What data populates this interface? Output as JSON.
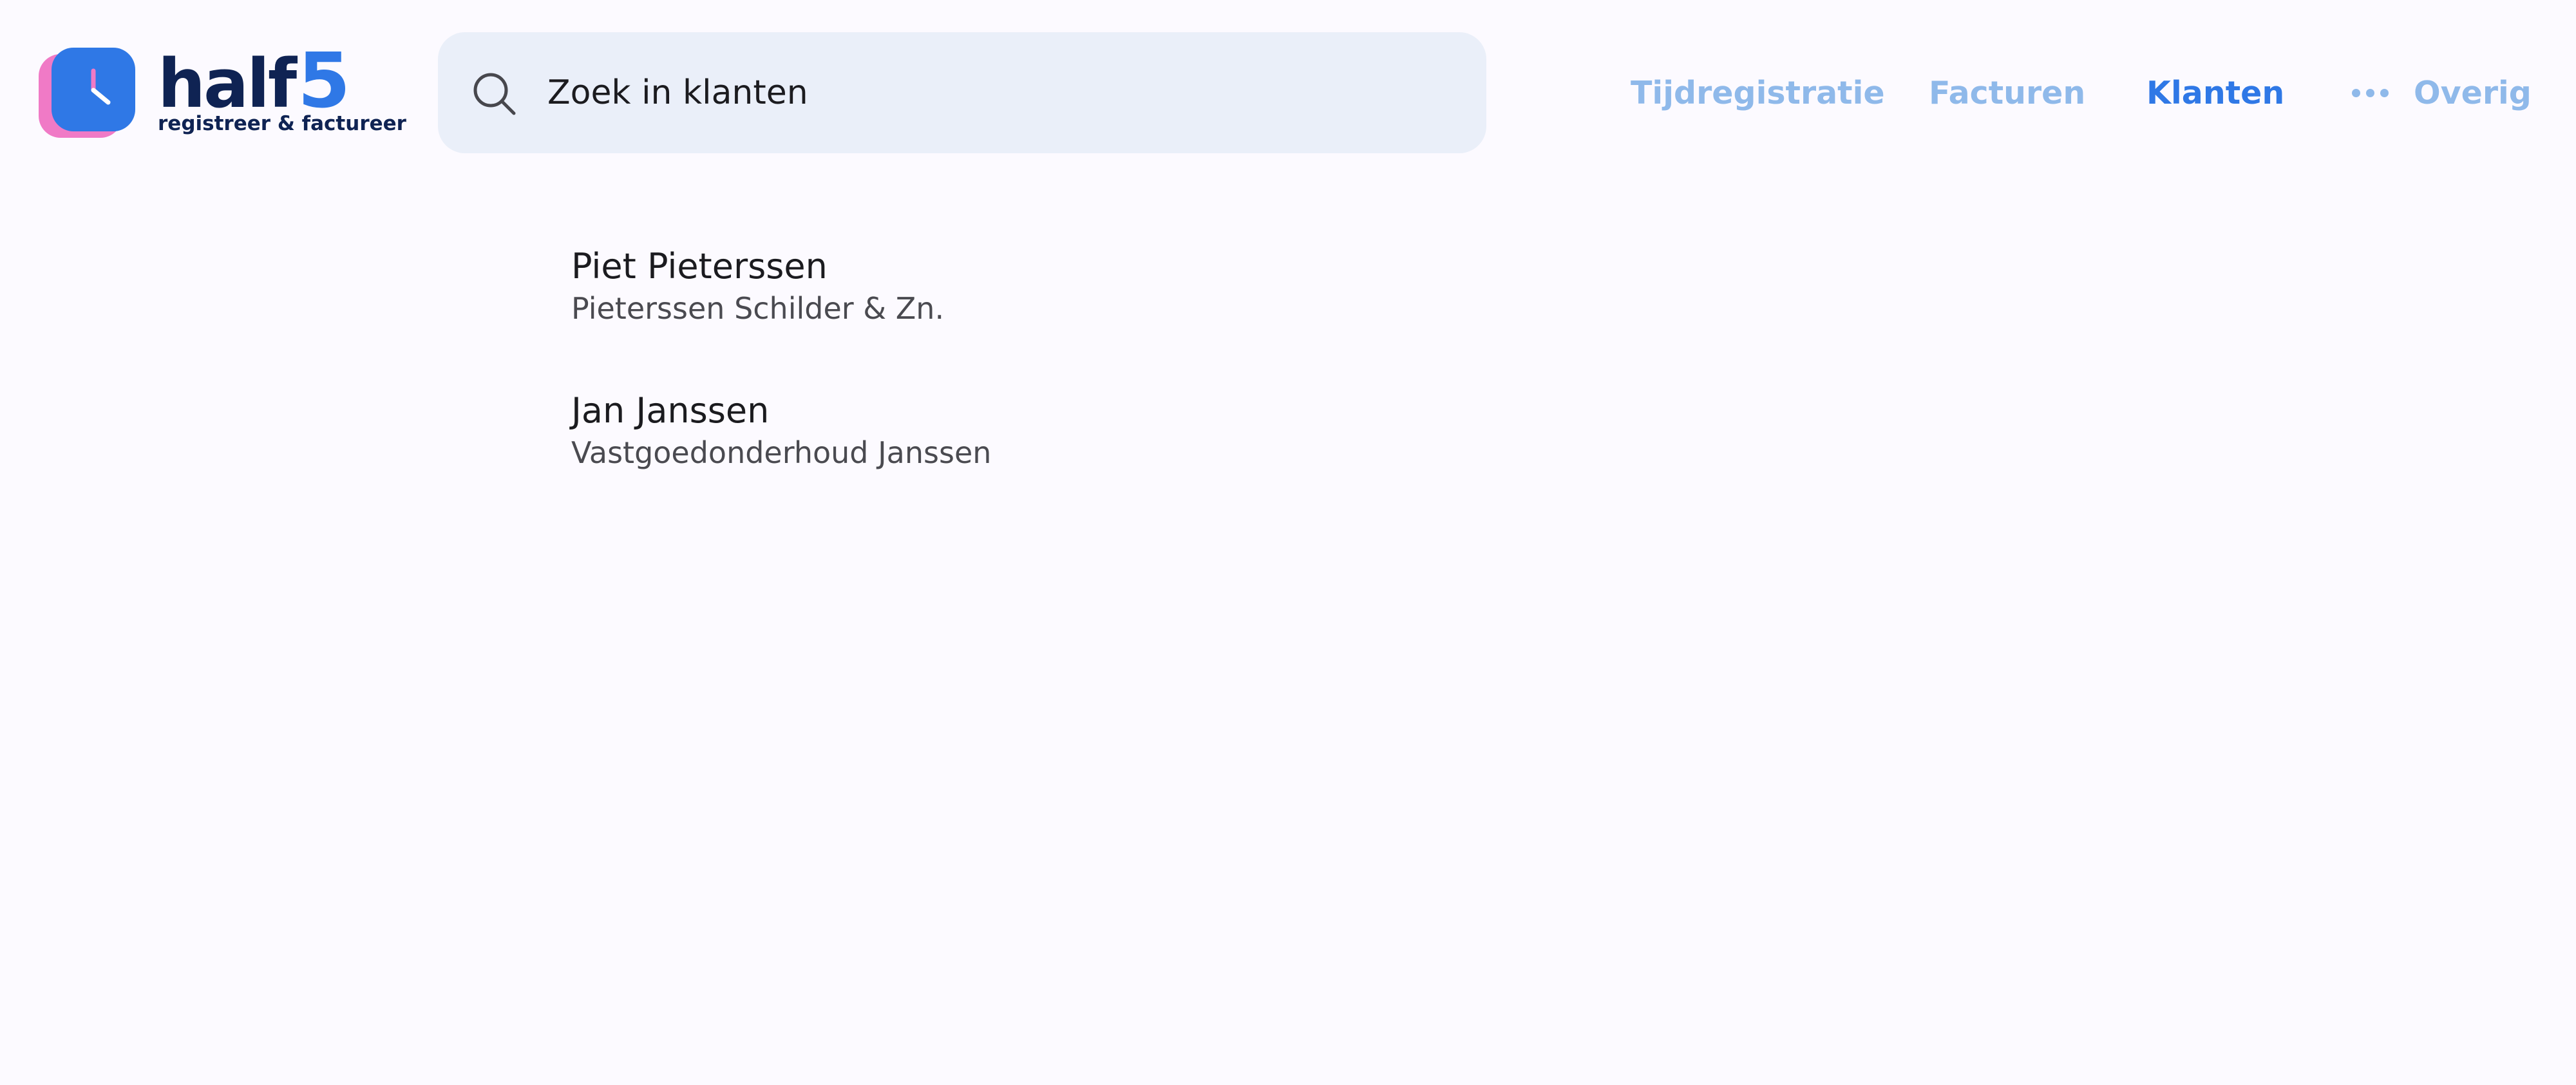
{
  "app": {
    "brand_name": "half",
    "brand_number": "5",
    "tagline": "registreer & factureer",
    "colors": {
      "background": "#fcfaff",
      "primary": "#2f78e6",
      "nav_inactive": "#8fb9ea",
      "brand_dark": "#0f2353",
      "logo_accent": "#f07ac6",
      "search_bg": "#eaeff9"
    }
  },
  "search": {
    "icon": "search-icon",
    "placeholder": "Zoek in klanten",
    "value": ""
  },
  "nav": {
    "items": [
      {
        "label": "Tijdregistratie",
        "active": false
      },
      {
        "label": "Facturen",
        "active": false
      },
      {
        "label": "Klanten",
        "active": true
      }
    ],
    "more": {
      "icon": "more-dots-icon",
      "label": "Overig"
    }
  },
  "clients": [
    {
      "name": "Piet Pieterssen",
      "company": "Pieterssen Schilder & Zn."
    },
    {
      "name": "Jan Janssen",
      "company": "Vastgoedonderhoud Janssen"
    }
  ]
}
